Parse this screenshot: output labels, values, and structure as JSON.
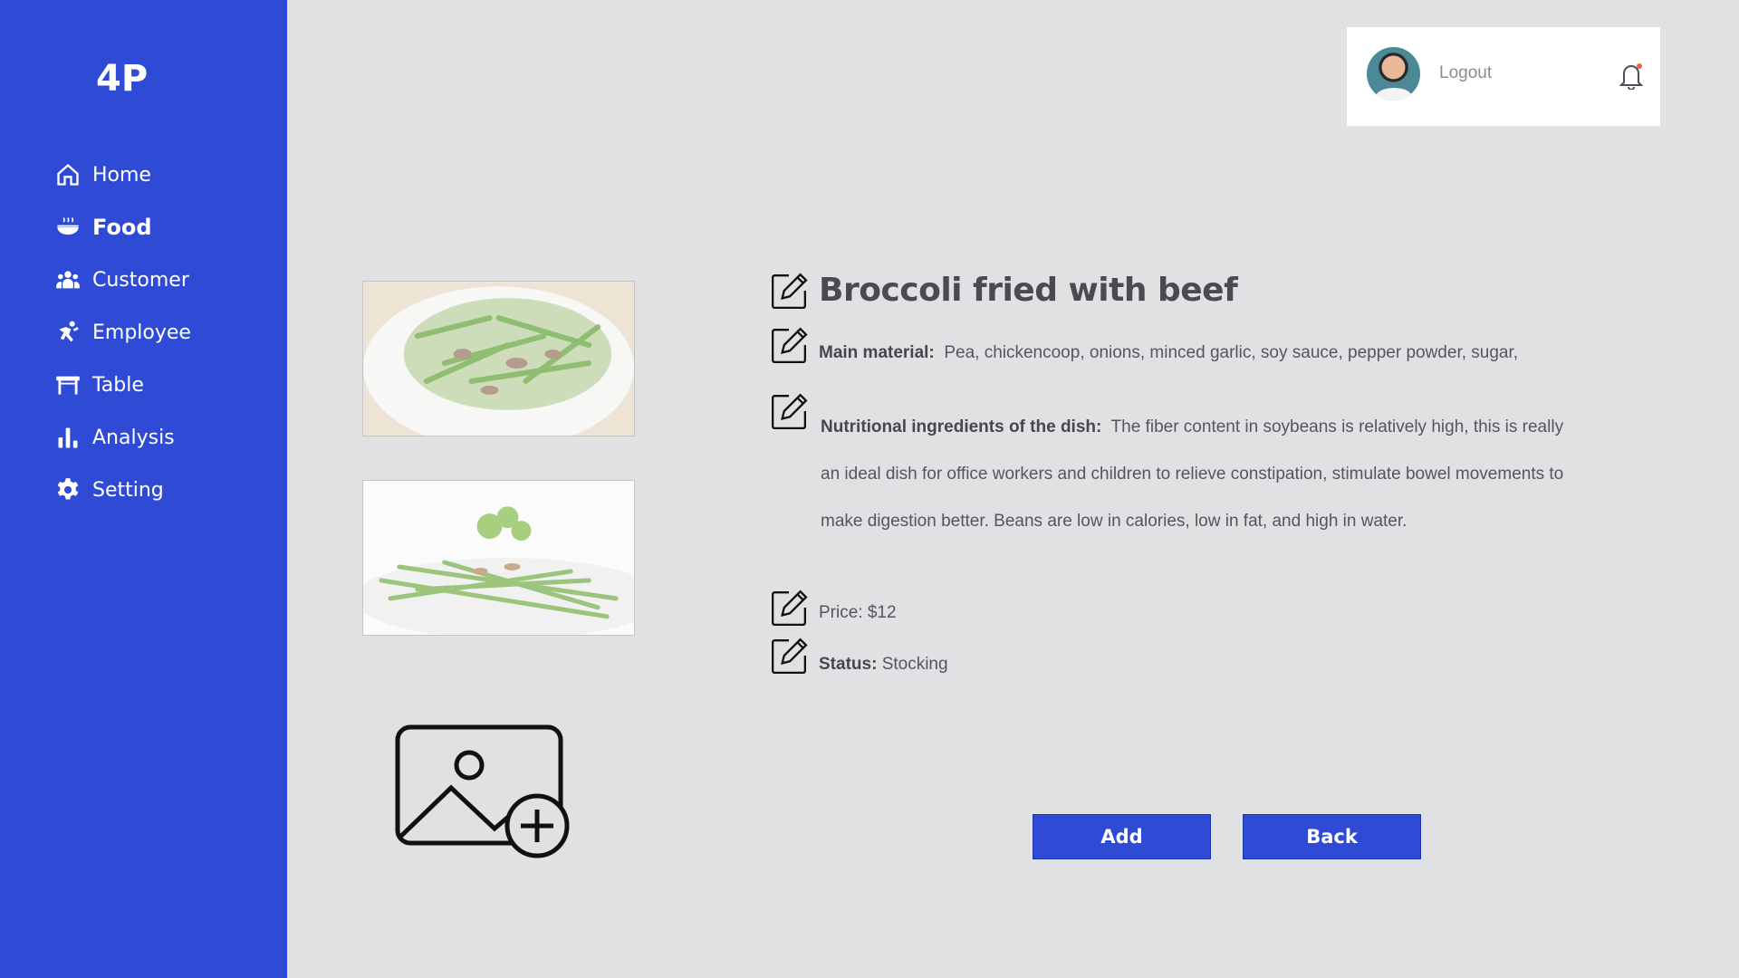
{
  "brand": {
    "logo": "4P"
  },
  "sidebar": {
    "items": [
      {
        "label": "Home",
        "icon": "home-icon",
        "active": false
      },
      {
        "label": "Food",
        "icon": "food-bowl-icon",
        "active": true
      },
      {
        "label": "Customer",
        "icon": "users-icon",
        "active": false
      },
      {
        "label": "Employee",
        "icon": "employee-icon",
        "active": false
      },
      {
        "label": "Table",
        "icon": "table-icon",
        "active": false
      },
      {
        "label": "Analysis",
        "icon": "bar-chart-icon",
        "active": false
      },
      {
        "label": "Setting",
        "icon": "gear-icon",
        "active": false
      }
    ]
  },
  "header": {
    "logout_label": "Logout",
    "notification_icon": "bell-icon"
  },
  "dish": {
    "title": "Broccoli fried with beef",
    "main_material_label": "Main material:",
    "main_material_value": "Pea, chickencoop, onions, minced garlic, soy sauce, pepper powder, sugar,",
    "nutrition_label": "Nutritional ingredients of the dish:",
    "nutrition_value": "The fiber  content in  soybeans is  relatively high,  this is really an ideal dish for office  workers and  children to relieve  constipation, stimulate bowel movements to make digestion better. Beans are low in calories, low in fat, and high in water.",
    "price_text": "Price: $12",
    "status_label": "Status:",
    "status_value": "Stocking"
  },
  "actions": {
    "add_label": "Add",
    "back_label": "Back"
  },
  "colors": {
    "sidebar": "#2f4bd6",
    "background": "#e0e1e3",
    "button": "#2f4bd6"
  }
}
